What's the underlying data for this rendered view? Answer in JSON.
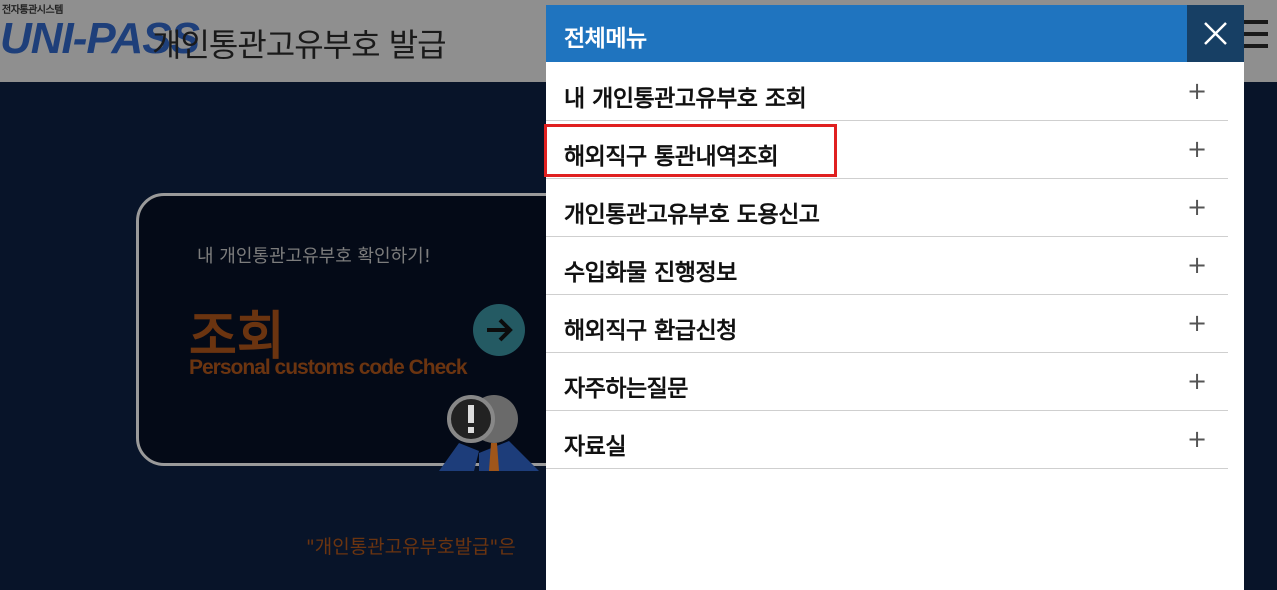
{
  "header": {
    "logo_small": "전자통관시스템",
    "logo_main": "UNI-PASS",
    "title": "개인통관고유부호 발급"
  },
  "card": {
    "subtitle": "내 개인통관고유부호 확인하기!",
    "title": "조회",
    "english": "Personal customs code Check"
  },
  "footer": {
    "text": "\"개인통관고유부호발급\"은"
  },
  "menu": {
    "title": "전체메뉴",
    "items": [
      {
        "label": "내 개인통관고유부호 조회",
        "expand": "+"
      },
      {
        "label": "해외직구 통관내역조회",
        "expand": "+"
      },
      {
        "label": "개인통관고유부호 도용신고",
        "expand": "+"
      },
      {
        "label": "수입화물 진행정보",
        "expand": "+"
      },
      {
        "label": "해외직구 환급신청",
        "expand": "+"
      },
      {
        "label": "자주하는질문",
        "expand": "+"
      },
      {
        "label": "자료실",
        "expand": "+"
      }
    ]
  },
  "colors": {
    "menu_header": "#1f74bf",
    "close_button": "#173f64",
    "highlight": "#e02020",
    "accent_orange": "#6b3410"
  },
  "icons": {
    "close": "close-icon",
    "hamburger": "hamburger-menu-icon",
    "arrow": "arrow-right-icon",
    "expand": "plus-icon"
  }
}
